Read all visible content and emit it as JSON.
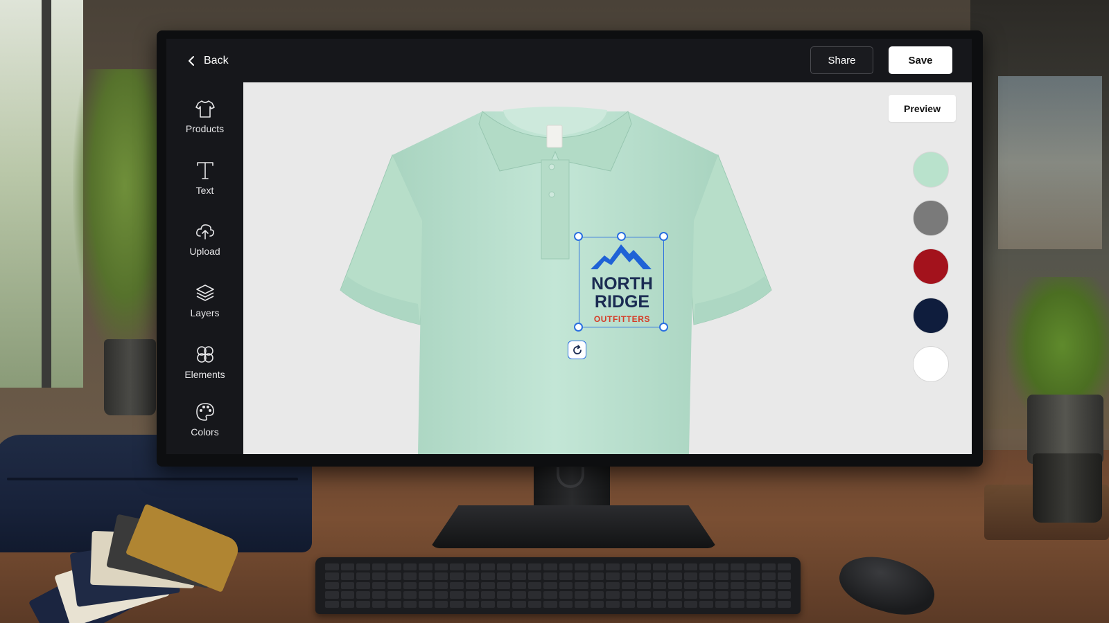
{
  "topbar": {
    "back_label": "Back",
    "share_label": "Share",
    "save_label": "Save"
  },
  "sidebar": {
    "items": [
      {
        "label": "Products",
        "icon": "tshirt-icon"
      },
      {
        "label": "Text",
        "icon": "text-icon"
      },
      {
        "label": "Upload",
        "icon": "cloud-upload-icon"
      },
      {
        "label": "Layers",
        "icon": "layers-icon"
      },
      {
        "label": "Elements",
        "icon": "elements-icon"
      },
      {
        "label": "Colors",
        "icon": "palette-icon"
      }
    ]
  },
  "canvas": {
    "preview_label": "Preview",
    "shirt_color": "#bfe3d2",
    "logo": {
      "line1": "NORTH",
      "line2": "RIDGE",
      "line3": "OUTFITTERS",
      "primary_color": "#1a2b52",
      "accent_color": "#d63b26",
      "mountain_color": "#1f62d6"
    },
    "selection_color": "#2a6fe0"
  },
  "color_swatches": [
    "#b9e2cc",
    "#7a7a7a",
    "#a3121c",
    "#0f1d3d",
    "#ffffff"
  ]
}
